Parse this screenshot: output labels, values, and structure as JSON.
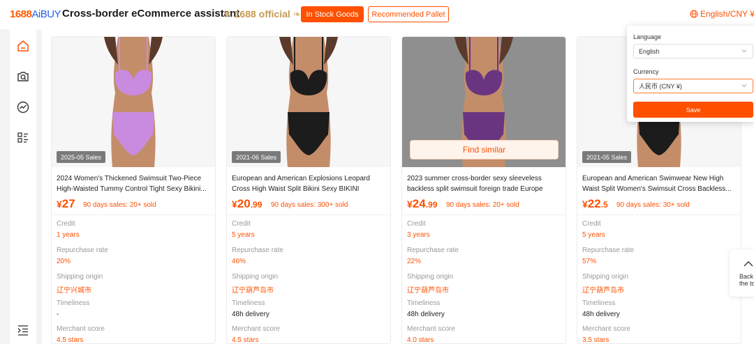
{
  "header": {
    "logo_number": "1688",
    "logo_brand": "AiBUY",
    "title": "Cross-border eCommerce assistant",
    "official": "1688 official",
    "in_stock_button": "In Stock Goods",
    "pallet_button": "Recommended Pallet",
    "language_currency": "English/CNY ¥"
  },
  "sidebar": {
    "items": [
      {
        "icon": "home-icon"
      },
      {
        "icon": "camera-search-icon"
      },
      {
        "icon": "trend-icon"
      },
      {
        "icon": "list-icon"
      },
      {
        "icon": "collapse-menu-icon"
      }
    ]
  },
  "settings_popover": {
    "language_label": "Language",
    "language_value": "English",
    "currency_label": "Currency",
    "currency_value": "人民币 (CNY ¥)",
    "save_label": "Save"
  },
  "labels": {
    "credit": "Credit",
    "repurchase": "Repurchase rate",
    "shipping": "Shipping origin",
    "timeliness": "Timeliness",
    "merchant": "Merchant score",
    "find_similar": "Find similar"
  },
  "products": [
    {
      "badge": "2025-05 Sales",
      "title": "2024 Women's Thickened Swimsuit Two-Piece High-Waisted Tummy Control Tight Sexy Bikini...",
      "price_symbol": "¥",
      "price_int": "27",
      "price_dec": "",
      "sales": "90 days sales: 20+ sold",
      "credit": "1 years",
      "repurchase": "20%",
      "shipping": "辽宁兴城市",
      "timeliness": "-",
      "merchant": "4.5 stars",
      "swimsuit_color": "#c98be0"
    },
    {
      "badge": "2021-06 Sales",
      "title": "European and American Explosions Leopard Cross High Waist Split Bikini Sexy BIKINI Swimsuit...",
      "price_symbol": "¥",
      "price_int": "20",
      "price_dec": ".99",
      "sales": "90 days sales: 300+ sold",
      "credit": "5 years",
      "repurchase": "46%",
      "shipping": "辽宁葫芦岛市",
      "timeliness": "48h delivery",
      "merchant": "4.5 stars",
      "swimsuit_color": "#1c1c1c"
    },
    {
      "badge": "",
      "title": "2023 summer cross-border sexy sleeveless backless split swimsuit foreign trade Europe and...",
      "price_symbol": "¥",
      "price_int": "24",
      "price_dec": ".99",
      "sales": "90 days sales: 20+ sold",
      "credit": "3 years",
      "repurchase": "22%",
      "shipping": "辽宁葫芦岛市",
      "timeliness": "48h delivery",
      "merchant": "4.0 stars",
      "swimsuit_color": "#6a3580"
    },
    {
      "badge": "2021-05 Sales",
      "title": "European and American Swimwear New High Waist Split Women's Swimsuit Cross Backless...",
      "price_symbol": "¥",
      "price_int": "22",
      "price_dec": ".5",
      "sales": "90 days sales: 30+ sold",
      "credit": "5 years",
      "repurchase": "57%",
      "shipping": "辽宁葫芦岛市",
      "timeliness": "48h delivery",
      "merchant": "3.5 stars",
      "swimsuit_color": "#1c1c1c"
    }
  ],
  "back_to_top": {
    "line1": "Back",
    "line2": "the to"
  },
  "colors": {
    "accent": "#ff5000",
    "brand_blue": "#2463eb",
    "gold": "#c79a52"
  }
}
